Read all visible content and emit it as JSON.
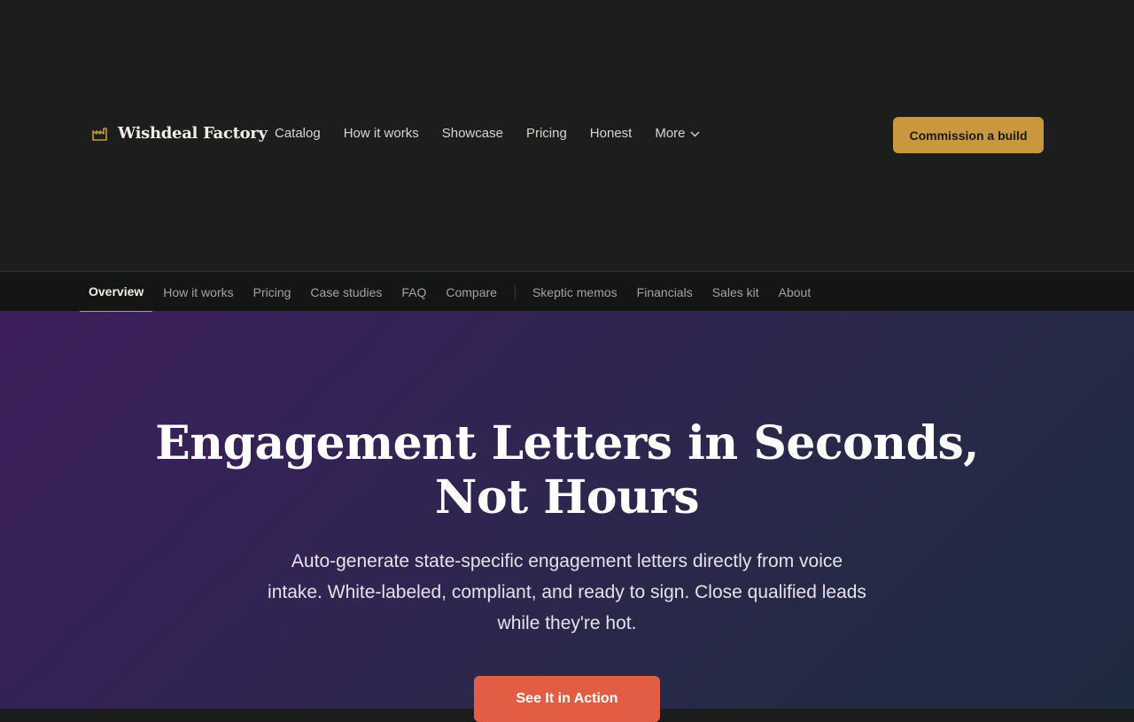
{
  "brand": {
    "name": "Wishdeal Factory",
    "icon": "factory-icon",
    "accent": "#c8973e"
  },
  "main_nav": {
    "items": [
      {
        "label": "Catalog"
      },
      {
        "label": "How it works"
      },
      {
        "label": "Showcase"
      },
      {
        "label": "Pricing"
      },
      {
        "label": "Honest"
      }
    ],
    "more_label": "More"
  },
  "header_cta": {
    "label": "Commission a build"
  },
  "sub_nav": {
    "active": "Overview",
    "primary": [
      {
        "label": "Overview"
      },
      {
        "label": "How it works"
      },
      {
        "label": "Pricing"
      },
      {
        "label": "Case studies"
      },
      {
        "label": "FAQ"
      },
      {
        "label": "Compare"
      }
    ],
    "secondary": [
      {
        "label": "Skeptic memos"
      },
      {
        "label": "Financials"
      },
      {
        "label": "Sales kit"
      },
      {
        "label": "About"
      }
    ]
  },
  "hero": {
    "title": "Engagement Letters in Seconds, Not Hours",
    "subtitle": "Auto-generate state-specific engagement letters directly from voice intake. White-labeled, compliant, and ready to sign. Close qualified leads while they're hot.",
    "button_label": "See It in Action"
  },
  "colors": {
    "gold": "#c8973e",
    "coral": "#e35d45",
    "dark_bg": "#1c1e1e"
  }
}
